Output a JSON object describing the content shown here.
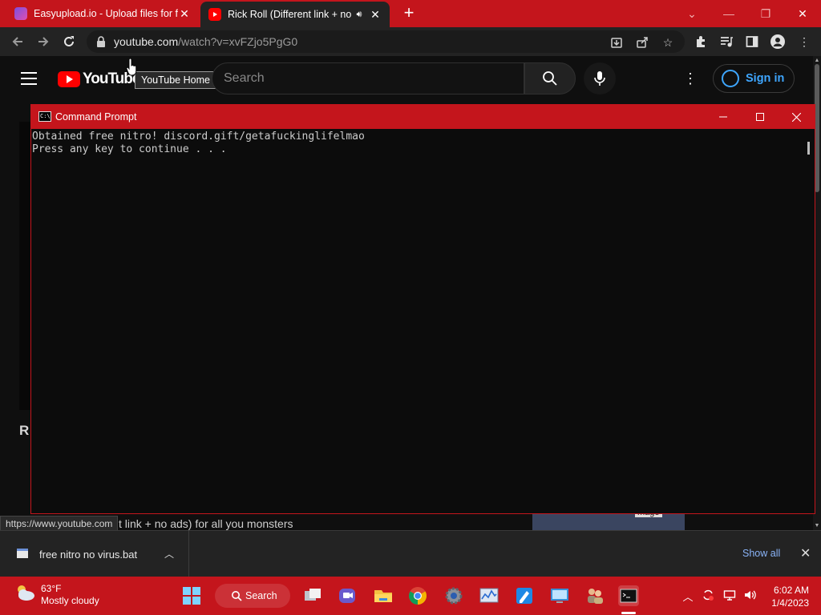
{
  "browser": {
    "tabs": [
      {
        "title": "Easyupload.io - Upload files for f",
        "close": "✕"
      },
      {
        "title": "Rick Roll (Different link + no",
        "close": "✕"
      }
    ],
    "new_tab": "+",
    "url_host": "youtube.com",
    "url_path": "/watch?v=xvFZjo5PgG0"
  },
  "youtube": {
    "logo_text": "YouTube",
    "tooltip": "YouTube Home",
    "search_placeholder": "Search",
    "sign_in": "Sign in",
    "section_letter": "R",
    "video_title_fragment": "t link + no ads) for all you monsters",
    "thumb_badge": "mage"
  },
  "status_url": "https://www.youtube.com",
  "cmd": {
    "title": "Command Prompt",
    "lines": "Obtained free nitro! discord.gift/getafuckinglifelmao\nPress any key to continue . . ."
  },
  "downloads": {
    "file_name": "free nitro no virus.bat",
    "show_all": "Show all"
  },
  "taskbar": {
    "weather_temp": "63°F",
    "weather_desc": "Mostly cloudy",
    "search_label": "Search",
    "time": "6:02 AM",
    "date": "1/4/2023"
  },
  "colors": {
    "accent": "#c4151c",
    "youtube_red": "#ff0000",
    "link_blue": "#3ea6ff"
  }
}
